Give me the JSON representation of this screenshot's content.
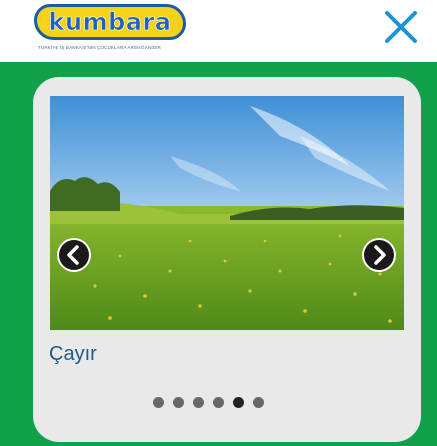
{
  "header": {
    "logo_text": "kumbara",
    "logo_tagline": "TÜRKİYE İŞ BANKASI'NIN ÇOCUKLARA ARMAĞANIDIR"
  },
  "icons": {
    "close": "close-icon",
    "prev": "chevron-left-icon",
    "next": "chevron-right-icon"
  },
  "colors": {
    "frame": "#12a04a",
    "card": "#e9e9e9",
    "close": "#1e93d2",
    "caption": "#1b5a8c",
    "logo_fill": "#f7d21a",
    "logo_outline": "#1c5aa6"
  },
  "slide": {
    "caption": "Çayır",
    "total_slides": 6,
    "active_slide": 5
  }
}
